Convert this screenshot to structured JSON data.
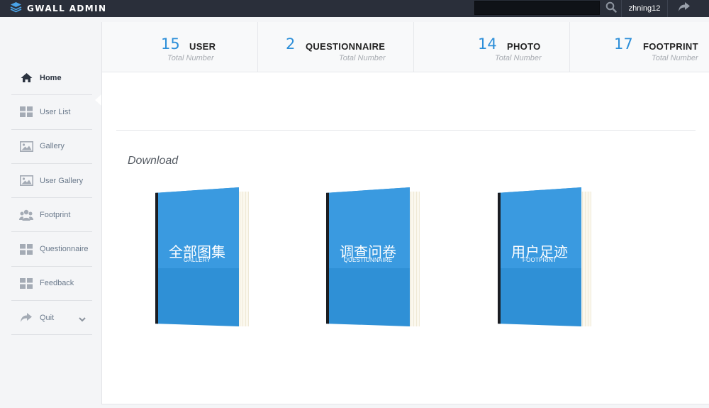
{
  "header": {
    "brand": "GWALL ADMIN",
    "search_value": "",
    "username": "zhning12"
  },
  "sidebar": {
    "items": [
      {
        "label": "Home",
        "icon": "home-icon",
        "active": true
      },
      {
        "label": "User List",
        "icon": "grid-icon"
      },
      {
        "label": "Gallery",
        "icon": "image-icon"
      },
      {
        "label": "User Gallery",
        "icon": "image-icon"
      },
      {
        "label": "Footprint",
        "icon": "users-icon"
      },
      {
        "label": "Questionnaire",
        "icon": "grid-icon"
      },
      {
        "label": "Feedback",
        "icon": "grid-icon"
      },
      {
        "label": "Quit",
        "icon": "share-icon",
        "has_caret": true
      }
    ]
  },
  "stats": [
    {
      "number": "15",
      "title": "USER",
      "sub": "Total Number"
    },
    {
      "number": "2",
      "title": "QUESTIONNAIRE",
      "sub": "Total Number"
    },
    {
      "number": "14",
      "title": "PHOTO",
      "sub": "Total Number"
    },
    {
      "number": "17",
      "title": "FOOTPRINT",
      "sub": "Total Number"
    }
  ],
  "download": {
    "title": "Download",
    "books": [
      {
        "title": "全部图集",
        "sub": "GALLERY"
      },
      {
        "title": "调查问卷",
        "sub": "QUESTIONNAIRE"
      },
      {
        "title": "用户足迹",
        "sub": "FOOTPRINT"
      }
    ]
  },
  "colors": {
    "accent": "#2d8fd9",
    "topbar": "#2a2f3a",
    "book_cover": "#2f90d6"
  }
}
